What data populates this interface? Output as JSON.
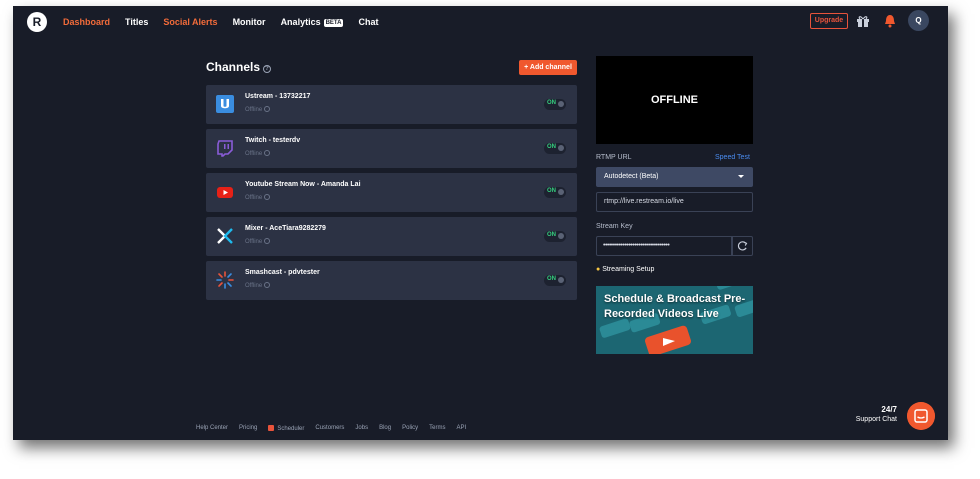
{
  "nav": {
    "logo": "R",
    "links": [
      {
        "label": "Dashboard",
        "active": true
      },
      {
        "label": "Titles",
        "active": false
      },
      {
        "label": "Social Alerts",
        "active": true
      },
      {
        "label": "Monitor",
        "active": false
      },
      {
        "label": "Analytics",
        "active": false
      },
      {
        "label": "Chat",
        "active": false
      }
    ],
    "beta": "BETA",
    "upgrade": "Upgrade",
    "avatar": "Q"
  },
  "channels": {
    "title": "Channels",
    "help": "?",
    "add_button": "+ Add channel",
    "items": [
      {
        "name": "Ustream - 13732217",
        "status": "Offline",
        "toggle": "ON",
        "icon": "ustream-icon"
      },
      {
        "name": "Twitch - testerdv",
        "status": "Offline",
        "toggle": "ON",
        "icon": "twitch-icon"
      },
      {
        "name": "Youtube Stream Now - Amanda Lai",
        "status": "Offline",
        "toggle": "ON",
        "icon": "youtube-icon"
      },
      {
        "name": "Mixer - AceTiara9282279",
        "status": "Offline",
        "toggle": "ON",
        "icon": "mixer-icon"
      },
      {
        "name": "Smashcast - pdvtester",
        "status": "Offline",
        "toggle": "ON",
        "icon": "smashcast-icon"
      }
    ]
  },
  "stream": {
    "preview": "OFFLINE",
    "rtmp_label": "RTMP URL",
    "speed_test": "Speed Test",
    "server": "Autodetect (Beta)",
    "rtmp_url": "rtmp://live.restream.io/live",
    "key_label": "Stream Key",
    "key_value": "••••••••••••••••••••••••••••••••••",
    "setup": "Streaming Setup",
    "banner": "Schedule & Broadcast Pre-Recorded Videos Live"
  },
  "footer": {
    "links": [
      "Help Center",
      "Pricing",
      "Scheduler",
      "Customers",
      "Jobs",
      "Blog",
      "Policy",
      "Terms",
      "API"
    ]
  },
  "support": {
    "line1": "24/7",
    "line2": "Support Chat"
  },
  "colors": {
    "background": "#181c28",
    "card": "#2c3244",
    "accent": "#f0582e",
    "link": "#4a8cf0",
    "on": "#35d07f"
  }
}
